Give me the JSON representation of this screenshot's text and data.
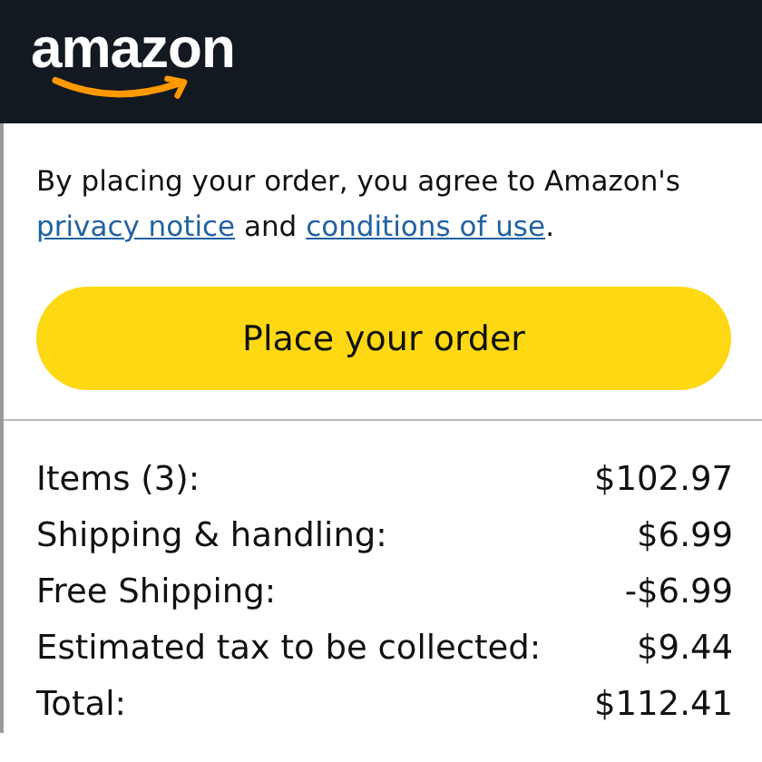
{
  "header": {
    "logo": "amazon"
  },
  "agreement": {
    "text": "By placing your order, you agree to Amazon's",
    "links": [
      "privacy notice",
      "conditions of use"
    ],
    "joiner": "and",
    "end": "."
  },
  "place_order_button": "Place your order",
  "summary": [
    {
      "label": "Items (3):",
      "amount": "$102.97"
    },
    {
      "label": "Shipping & handling:",
      "amount": "$6.99"
    },
    {
      "label": "Free Shipping:",
      "amount": "-$6.99"
    },
    {
      "label": "Estimated tax to be collected:",
      "amount": "$9.44"
    },
    {
      "label": "Total:",
      "amount": "$112.41"
    }
  ]
}
